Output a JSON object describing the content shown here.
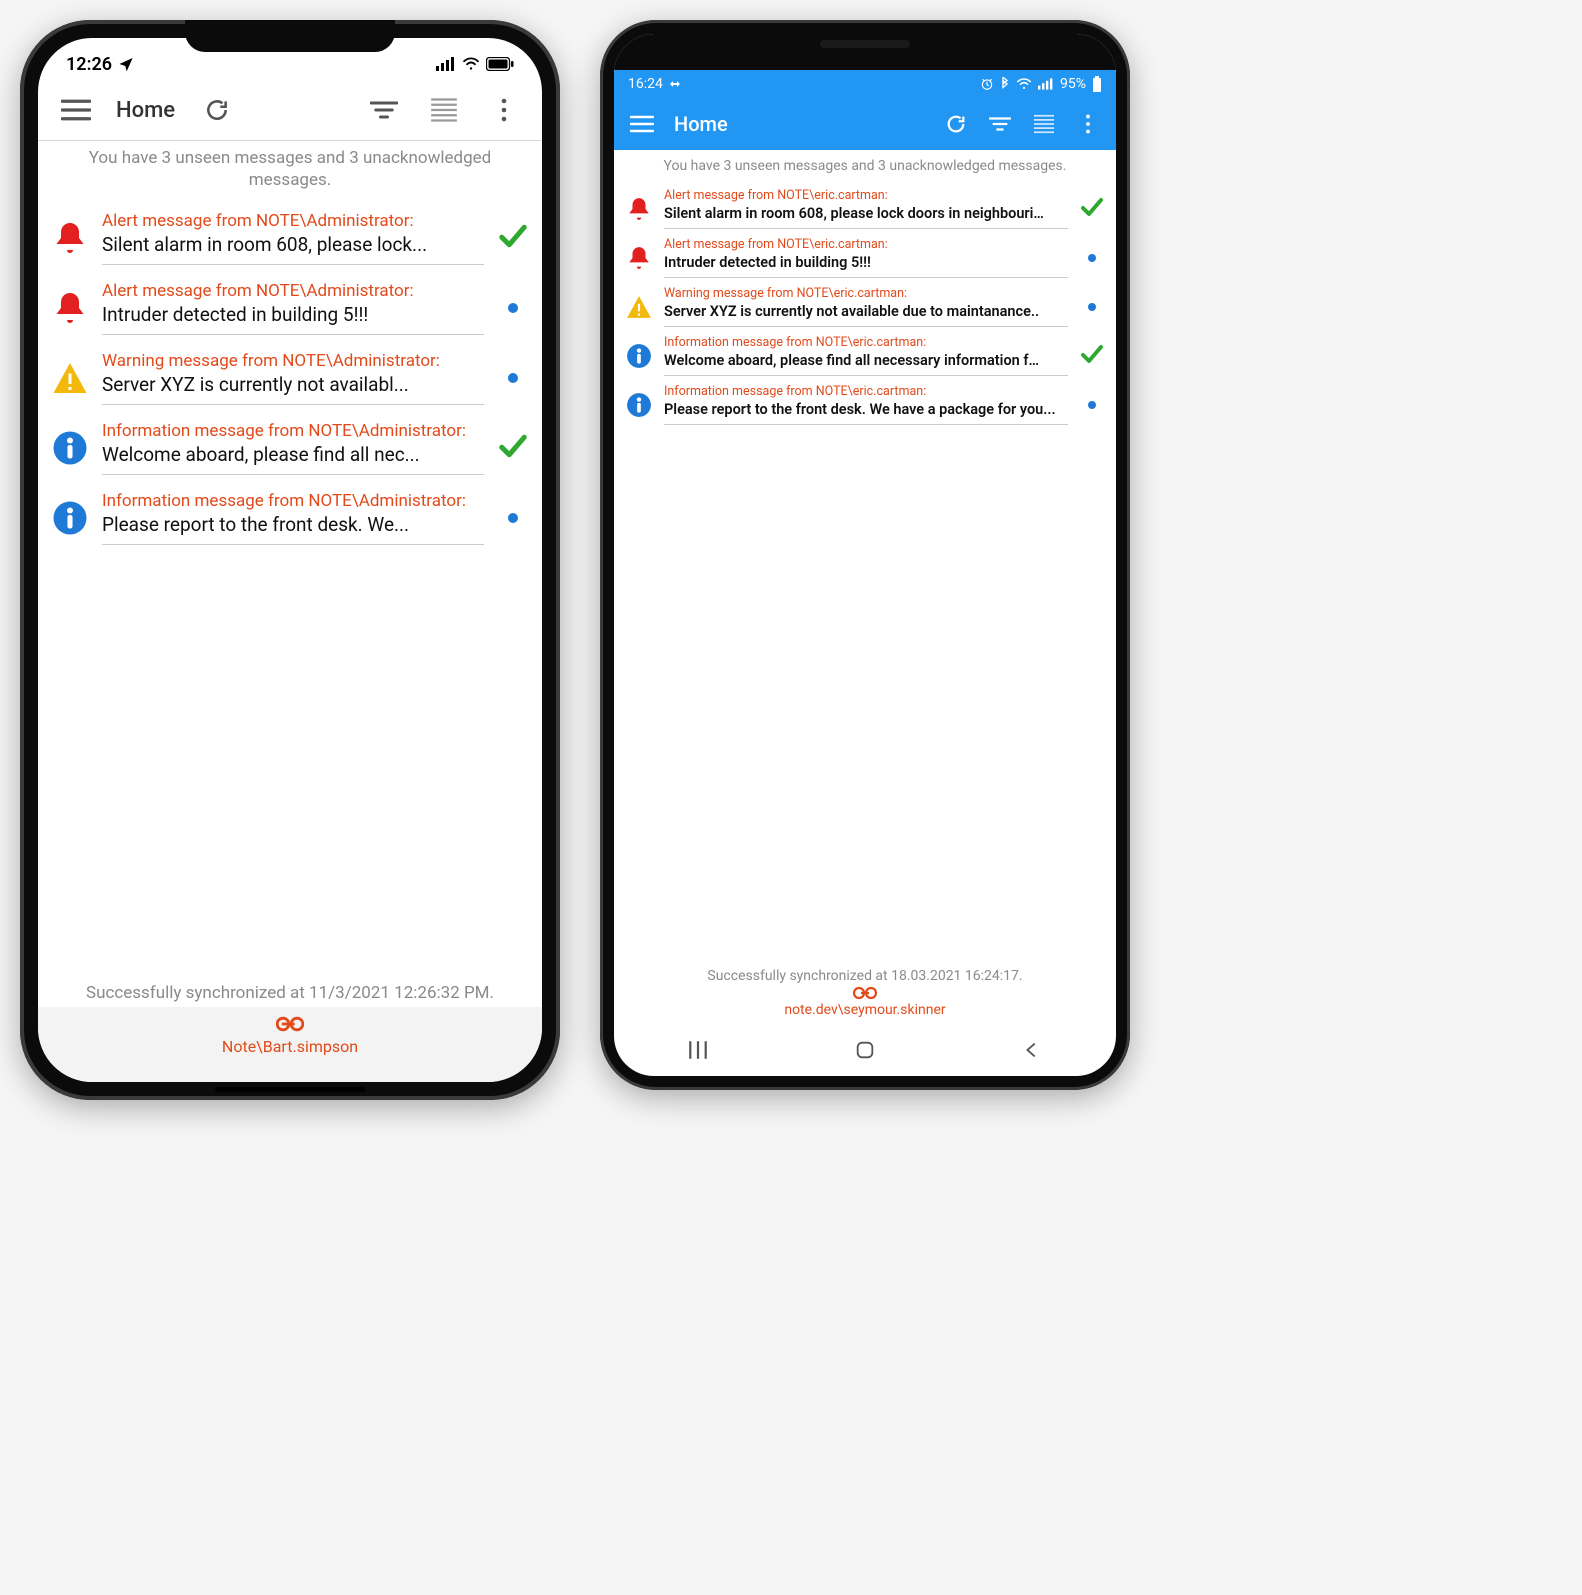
{
  "ios": {
    "status": {
      "time": "12:26"
    },
    "appbar": {
      "title": "Home"
    },
    "summary": "You have 3 unseen messages and 3 unacknowledged messages.",
    "messages": [
      {
        "type": "alert",
        "from": "Alert message from NOTE\\Administrator:",
        "text": "Silent alarm in room 608, please lock...",
        "status": "ack"
      },
      {
        "type": "alert",
        "from": "Alert message from NOTE\\Administrator:",
        "text": "Intruder detected in building 5!!!",
        "status": "unread"
      },
      {
        "type": "warning",
        "from": "Warning message from NOTE\\Administrator:",
        "text": "Server XYZ is currently not availabl...",
        "status": "unread"
      },
      {
        "type": "info",
        "from": "Information message from NOTE\\Administrator:",
        "text": "Welcome aboard, please find all nec...",
        "status": "ack"
      },
      {
        "type": "info",
        "from": "Information message from NOTE\\Administrator:",
        "text": "Please report to the front desk. We...",
        "status": "unread"
      }
    ],
    "sync": "Successfully synchronized at 11/3/2021 12:26:32 PM.",
    "link": "Note\\Bart.simpson"
  },
  "android": {
    "status": {
      "time": "16:24",
      "battery": "95%"
    },
    "appbar": {
      "title": "Home"
    },
    "summary": "You have 3 unseen messages and 3 unacknowledged messages.",
    "messages": [
      {
        "type": "alert",
        "from": "Alert message from NOTE\\eric.cartman:",
        "text": "Silent alarm in room 608, please lock doors in neighbouri…",
        "status": "ack"
      },
      {
        "type": "alert",
        "from": "Alert message from NOTE\\eric.cartman:",
        "text": "Intruder detected in building 5!!!",
        "status": "unread"
      },
      {
        "type": "warning",
        "from": "Warning message from NOTE\\eric.cartman:",
        "text": "Server XYZ is currently not available due to maintanance..",
        "status": "unread"
      },
      {
        "type": "info",
        "from": "Information message from NOTE\\eric.cartman:",
        "text": "Welcome aboard, please find all necessary information f…",
        "status": "ack"
      },
      {
        "type": "info",
        "from": "Information message from NOTE\\eric.cartman:",
        "text": "Please report to the front desk. We have a package for you...",
        "status": "unread"
      }
    ],
    "sync": "Successfully synchronized at 18.03.2021 16:24:17.",
    "link": "note.dev\\seymour.skinner"
  }
}
